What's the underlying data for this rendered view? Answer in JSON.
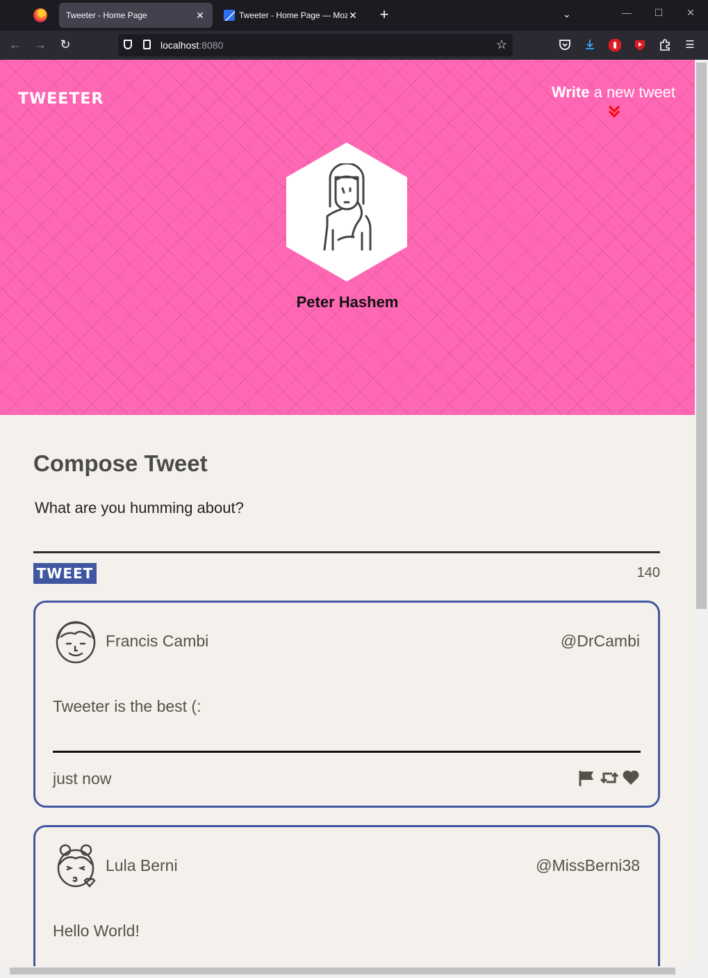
{
  "browser": {
    "tabs": [
      {
        "title": "Tweeter - Home Page",
        "active": true
      },
      {
        "title": "Tweeter - Home Page — Mozilla Firefox",
        "active": false
      }
    ],
    "url_host": "localhost",
    "url_port": ":8080"
  },
  "header": {
    "brand": "tweeter",
    "write_bold": "Write",
    "write_rest": " a new tweet",
    "profile_name": "Peter Hashem"
  },
  "compose": {
    "title": "Compose Tweet",
    "placeholder": "What are you humming about?",
    "button_label": "tweet",
    "counter": "140"
  },
  "tweets": [
    {
      "name": "Francis Cambi",
      "handle": "@DrCambi",
      "text": "Tweeter is the best (:",
      "time": "just now"
    },
    {
      "name": "Lula Berni",
      "handle": "@MissBerni38",
      "text": "Hello World!"
    }
  ],
  "colors": {
    "hero": "#ff66b3",
    "accent": "#4056a1",
    "arrow": "#ff0000",
    "page_bg": "#f4f1ec"
  }
}
